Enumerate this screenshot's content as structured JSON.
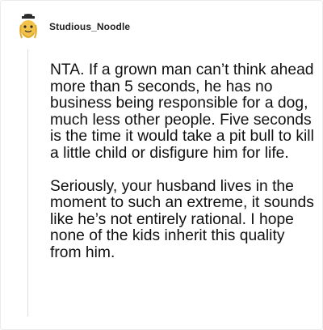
{
  "comment": {
    "username": "Studious_Noodle",
    "avatar_icon": "noodle-avatar-icon",
    "paragraphs": [
      "NTA. If a grown man can’t think ahead more than 5 seconds, he has no business being responsible for a dog, much less other people. Five seconds is the time it would take a pit bull to kill a little child or disfigure him for life.",
      "Seriously, your husband lives in the moment to such an extreme, it sounds like he’s not entirely rational. I hope none of the kids inherit this quality from him."
    ]
  },
  "colors": {
    "text": "#111111",
    "username": "#222222",
    "thread_line": "#dcdcdc",
    "avatar_hat": "#2b2b2b",
    "avatar_face": "#f2c24a"
  }
}
